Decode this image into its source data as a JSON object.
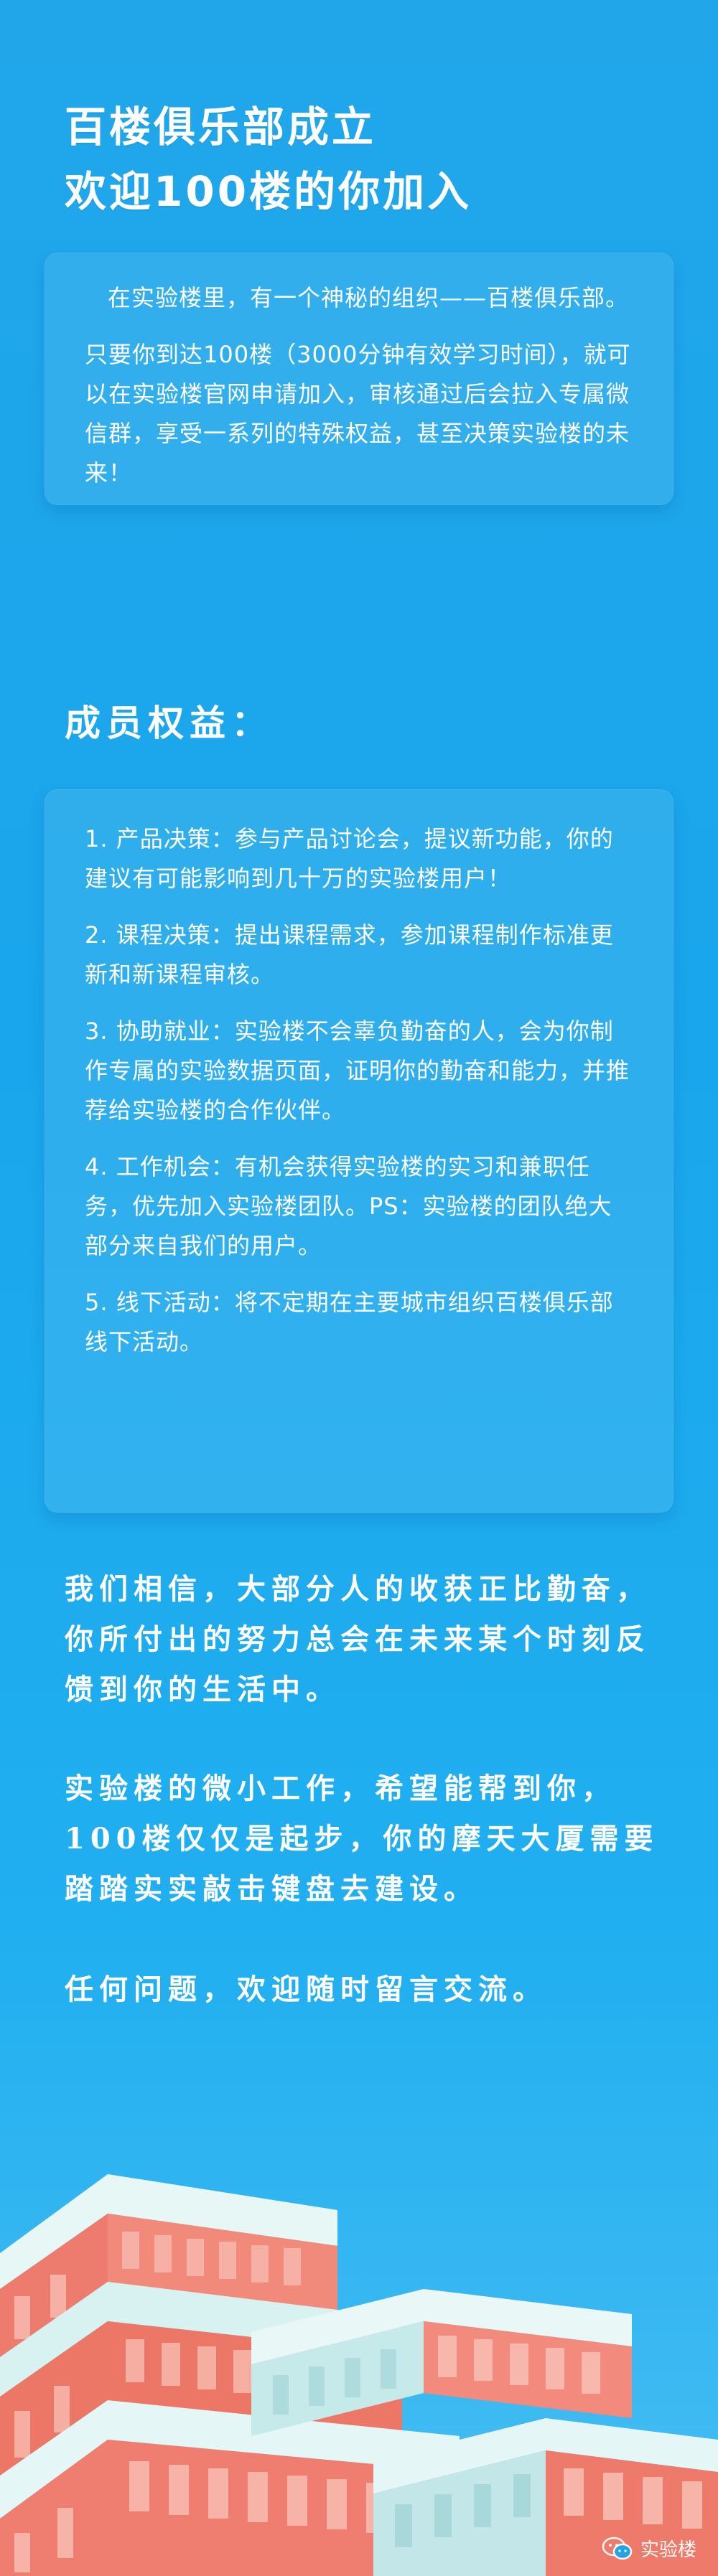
{
  "title": {
    "line1": "百楼俱乐部成立",
    "line2": "欢迎100楼的你加入"
  },
  "intro": {
    "p1": "在实验楼里，有一个神秘的组织——百楼俱乐部。",
    "p2": "只要你到达100楼（3000分钟有效学习时间），就可以在实验楼官网申请加入，审核通过后会拉入专属微信群，享受一系列的特殊权益，甚至决策实验楼的未来！"
  },
  "benefits": {
    "heading": "成员权益：",
    "items": [
      "1. 产品决策：参与产品讨论会，提议新功能，你的建议有可能影响到几十万的实验楼用户！",
      "2. 课程决策：提出课程需求，参加课程制作标准更新和新课程审核。",
      "3. 协助就业：实验楼不会辜负勤奋的人，会为你制作专属的实验数据页面，证明你的勤奋和能力，并推荐给实验楼的合作伙伴。",
      "4. 工作机会：有机会获得实验楼的实习和兼职任务，优先加入实验楼团队。PS：实验楼的团队绝大部分来自我们的用户。",
      "5. 线下活动：将不定期在主要城市组织百楼俱乐部线下活动。"
    ]
  },
  "closing": {
    "p1": "我们相信，大部分人的收获正比勤奋，你所付出的努力总会在未来某个时刻反馈到你的生活中。",
    "p2": "实验楼的微小工作，希望能帮到你，100楼仅仅是起步，你的摩天大厦需要踏踏实实敲击键盘去建设。",
    "p3": "任何问题，欢迎随时留言交流。"
  },
  "watermark": {
    "icon": "wechat-icon",
    "text": "实验楼"
  },
  "colors": {
    "background": "#1aa6ec",
    "building_wall": "#c9ecec",
    "building_accent": "#f07a6c"
  }
}
